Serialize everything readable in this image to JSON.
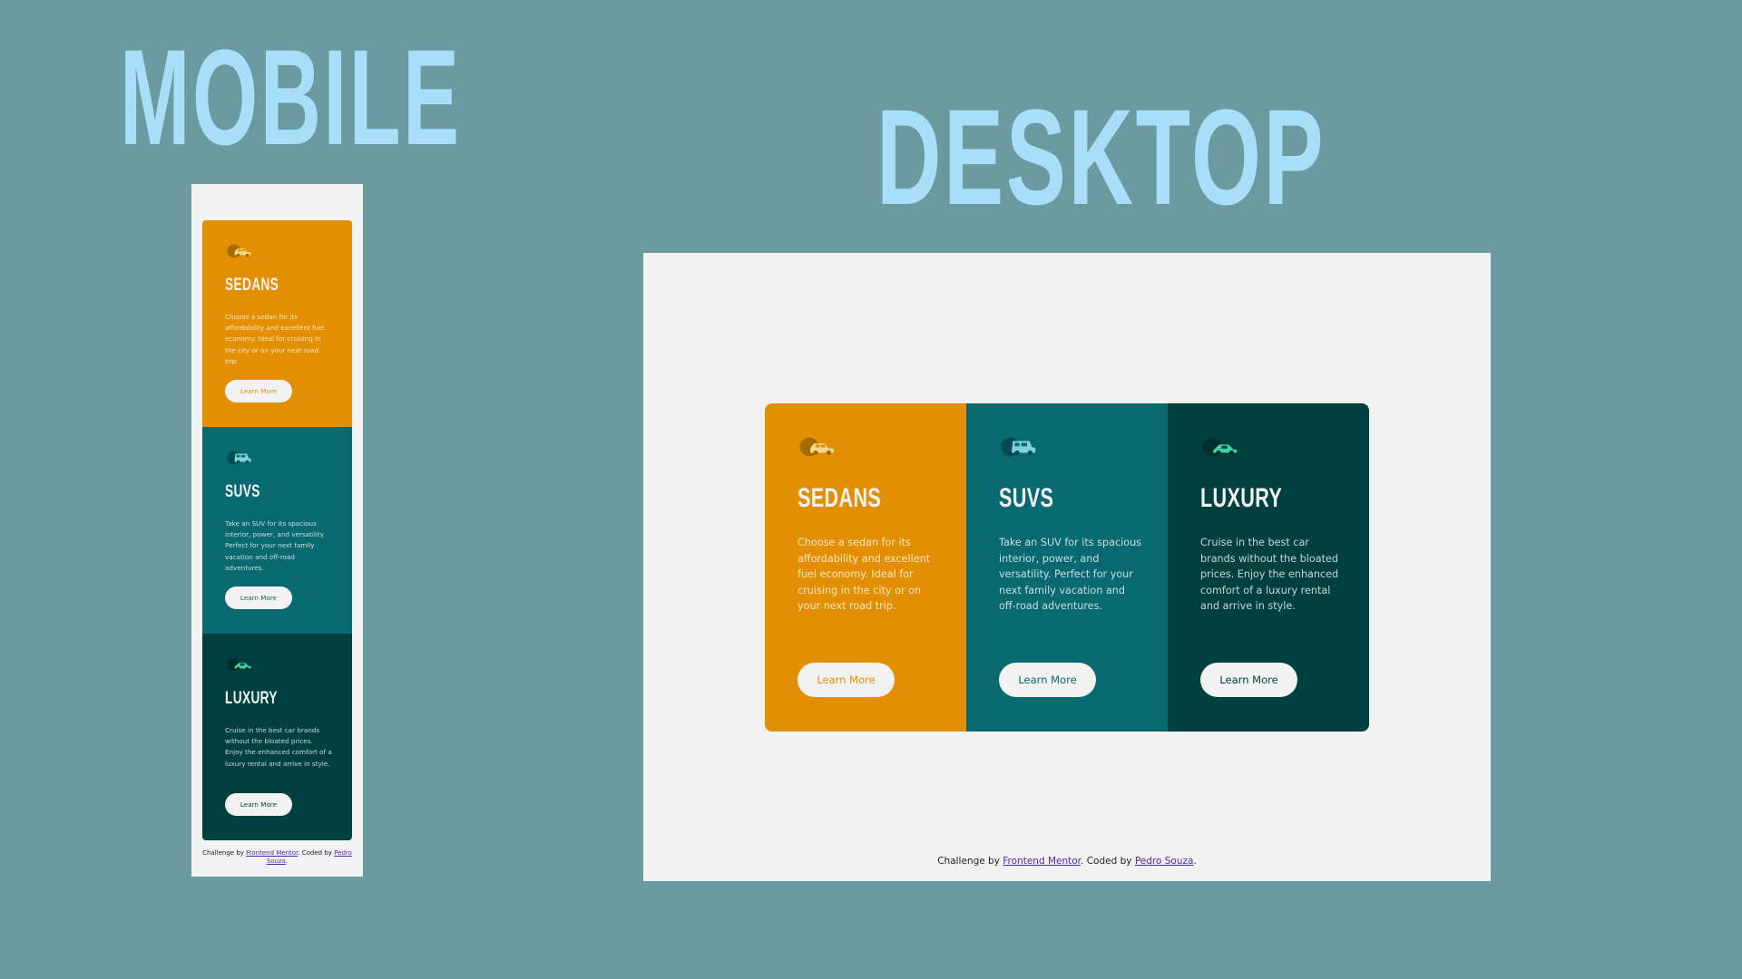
{
  "titles": {
    "mobile": "MOBILE",
    "desktop": "DESKTOP"
  },
  "colors": {
    "background": "#6b9aa0",
    "title": "#a8def7",
    "frame": "#f2f2f2",
    "sedans": "#e28f03",
    "suvs": "#086970",
    "luxury": "#004140"
  },
  "cards": [
    {
      "title": "SEDANS",
      "text": "Choose a sedan for its affordability and excellent fuel economy. Ideal for cruising in the city or on your next road trip.",
      "button": "Learn More",
      "icon": "sedan-car-icon"
    },
    {
      "title": "SUVS",
      "text": "Take an SUV for its spacious interior, power, and versatility. Perfect for your next family vacation and off-road adventures.",
      "button": "Learn More",
      "icon": "suv-car-icon"
    },
    {
      "title": "LUXURY",
      "text": "Cruise in the best car brands without the bloated prices. Enjoy the enhanced comfort of a luxury rental and arrive in style.",
      "button": "Learn More",
      "icon": "luxury-car-icon"
    }
  ],
  "attribution": {
    "prefix": "Challenge by",
    "link1": "Frontend Mentor",
    "middle": ". Coded by",
    "link2": "Pedro Souza",
    "suffix": "."
  }
}
